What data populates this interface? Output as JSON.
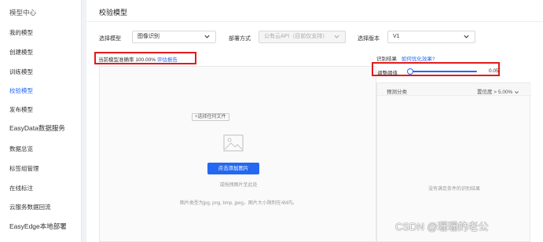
{
  "sidebar": {
    "header": "模型中心",
    "items": [
      {
        "label": "我的模型"
      },
      {
        "label": "创建模型"
      },
      {
        "label": "训练模型"
      },
      {
        "label": "校验模型"
      },
      {
        "label": "发布模型"
      },
      {
        "label": "EasyData数据服务"
      },
      {
        "label": "数据总览"
      },
      {
        "label": "标签组管理"
      },
      {
        "label": "在线标注"
      },
      {
        "label": "云服务数据回流"
      },
      {
        "label": "EasyEdge本地部署"
      }
    ],
    "active_index": 3
  },
  "main": {
    "title": "校验模型",
    "form": {
      "model_label": "选择模型",
      "model_value": "图像识别",
      "deploy_label": "部署方式",
      "deploy_value": "公有云API（目前仅支持）",
      "version_label": "选择版本",
      "version_value": "V1"
    },
    "accuracy": {
      "label": "当前模型准确率",
      "value": "100.00%",
      "link": "评估报告"
    },
    "upload": {
      "choose_file": "+选择任何文件",
      "button": "点击添加图片",
      "drag_hint": "或拖拽图片至此处",
      "format_hint": "图片类型为jpg, png, bmp, jpeg，图片大小限制在4M内。"
    },
    "result": {
      "label": "识别结果",
      "optimize_link": "如何优化效果?",
      "threshold_label": "调整阈值",
      "threshold_value": "0.05",
      "threshold_fraction": 0.05,
      "col_category": "预测分类",
      "col_confidence": "置信度 > 5.00%",
      "empty": "没有满足条件的识别结果"
    }
  },
  "watermark": "CSDN @珊珊的老公",
  "colors": {
    "accent": "#2468f2",
    "highlight": "#e21b1b"
  }
}
